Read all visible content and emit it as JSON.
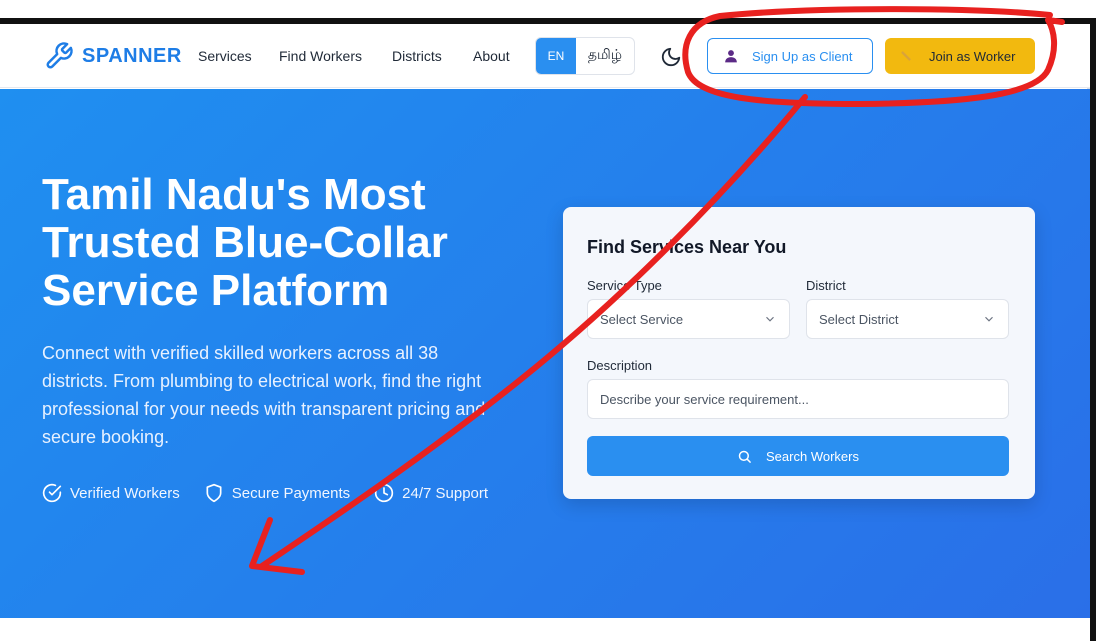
{
  "brand": {
    "name": "SPANNER"
  },
  "nav": {
    "links": [
      "Services",
      "Find Workers",
      "Districts",
      "About"
    ],
    "lang_en": "EN",
    "lang_ta": "தமிழ்",
    "client_button": "Sign Up as Client",
    "worker_button": "Join as Worker"
  },
  "hero": {
    "title_lines": [
      "Tamil Nadu's Most",
      "Trusted Blue-Collar",
      "Service Platform"
    ],
    "description": "Connect with verified skilled workers across all 38 districts. From plumbing to electrical work, find the right professional for your needs with transparent pricing and secure booking.",
    "features": [
      "Verified Workers",
      "Secure Payments",
      "24/7 Support"
    ]
  },
  "search_card": {
    "title": "Find Services Near You",
    "service_label": "Service Type",
    "service_placeholder": "Select Service",
    "district_label": "District",
    "district_placeholder": "Select District",
    "description_label": "Description",
    "description_placeholder": "Describe your service requirement...",
    "search_button": "Search Workers"
  },
  "colors": {
    "brand": "#1e7de6",
    "primary": "#2a8ff0",
    "accent": "#f2b90f",
    "annotation": "#e8211f"
  }
}
